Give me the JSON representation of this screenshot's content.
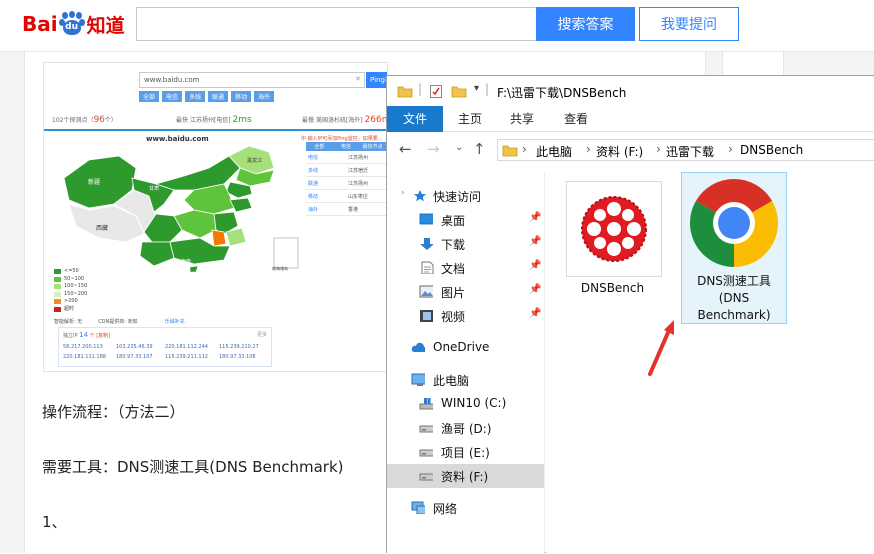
{
  "header": {
    "logo_left": "Bai",
    "logo_paw": "du",
    "logo_right": "知道",
    "search_value": "",
    "search_button": "搜索答案",
    "ask_button": "我要提问"
  },
  "article": {
    "step_heading": "操作流程：（方法二）",
    "tool_line": "需要工具：DNS测速工具(DNS Benchmark)",
    "step_one": "1、"
  },
  "embedded_screenshot": {
    "search_value": "www.baidu.com",
    "search_button": "Ping检测",
    "tabs": [
      "全部",
      "电信",
      "多线",
      "联通",
      "移动",
      "海外"
    ],
    "stats": {
      "nodes_label": "102个探测点（",
      "nodes_value": "96",
      "nodes_suffix": "个）",
      "fastest_label": "最快",
      "fastest_node": "江苏扬州[电信]",
      "fastest_value": "2ms",
      "slowest_label": "最慢",
      "slowest_node": "美国洛杉矶[海外]",
      "slowest_value": "266ms"
    },
    "map_title": "www.baidu.com",
    "note": "中 输入IP可添加Ping监控，如果要...",
    "regions": [
      "新疆",
      "西藏",
      "甘肃",
      "黑龙江",
      "海南",
      "南海诸岛"
    ],
    "legend": [
      "<=50",
      "50~100",
      "100~150",
      "150~200",
      ">200",
      "超时"
    ],
    "table_header": [
      "全部",
      "电信",
      "最快节点"
    ],
    "table_rows": [
      {
        "isp": "电信",
        "node": "江苏扬州"
      },
      {
        "isp": "多线",
        "node": "江苏宿迁"
      },
      {
        "isp": "联通",
        "node": "江苏扬州"
      },
      {
        "isp": "移动",
        "node": "山东枣庄"
      },
      {
        "isp": "海外",
        "node": "香港"
      }
    ],
    "bottom_left": "智能解析: 无",
    "bottom_mid": "CDN提供商: 未知",
    "bottom_right": "乐域补充",
    "footer_title": "独立IP",
    "footer_count": "14",
    "footer_count_suffix": "个 [复制]",
    "footer_more": "更多",
    "footer_ips": [
      "58.217.200.113",
      "103.235.46.39",
      "220.181.112.244",
      "115.239.210.27",
      "220.181.111.188",
      "180.97.33.107",
      "115.239.211.112",
      "180.97.33.108"
    ],
    "colors": {
      "fast": "#2e9a2e",
      "mid": "#5ec43b",
      "slow": "#a6e07a",
      "slower": "#d7f0b5",
      "very_slow": "#f08c2c",
      "timeout": "#d11f1f",
      "no_data": "#e8e8e8",
      "hot": "#f57900"
    }
  },
  "explorer": {
    "title_path": "F:\\迅雷下载\\DNSBench",
    "ribbon_tabs": [
      "文件",
      "主页",
      "共享",
      "查看"
    ],
    "breadcrumb": [
      "此电脑",
      "资料 (F:)",
      "迅雷下载",
      "DNSBench"
    ],
    "sidebar": {
      "quick_access": "快速访问",
      "quick_items": [
        "桌面",
        "下载",
        "文档",
        "图片",
        "视频"
      ],
      "onedrive": "OneDrive",
      "this_pc": "此电脑",
      "drives": [
        "WIN10 (C:)",
        "渔哥 (D:)",
        "项目 (E:)",
        "资料 (F:)"
      ],
      "network": "网络"
    },
    "files": [
      {
        "name": "DNSBench",
        "icon": "dnsbench-icon"
      },
      {
        "name": "DNS测速工具 (DNS Benchmark)",
        "name_lines": [
          "DNS测速工具",
          "(DNS",
          "Benchmark)"
        ],
        "icon": "chrome-icon"
      }
    ],
    "colors": {
      "file_tab": "#1979ca",
      "selection": "#e5f3fb",
      "selection_border": "#99d1f0",
      "arrow": "#e3322b"
    }
  }
}
